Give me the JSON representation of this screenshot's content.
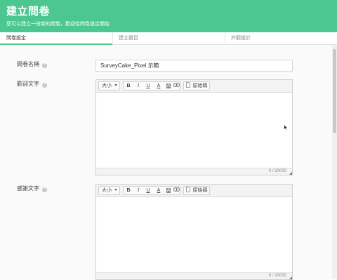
{
  "header": {
    "title": "建立問卷",
    "subtitle": "您可以建立一份新的問卷，歡迎從問卷設定開始"
  },
  "tabs": [
    {
      "label": "問卷設定"
    },
    {
      "label": "建立題目"
    },
    {
      "label": "外觀設計"
    }
  ],
  "form": {
    "name_label": "問卷名稱",
    "name_value": "SurveyCake_Pixel 示範",
    "welcome_label": "歡迎文字",
    "thanks_label": "感謝文字",
    "help_glyph": "?"
  },
  "toolbar": {
    "size_label": "大小",
    "bold": "B",
    "italic": "I",
    "underline": "U",
    "text_color": "A",
    "bg_color": "A",
    "source_label": "原始碼"
  },
  "editors": {
    "welcome_counter": "0 / 20000",
    "thanks_counter": "0 / 20000"
  },
  "colors": {
    "accent": "#4cc790"
  }
}
